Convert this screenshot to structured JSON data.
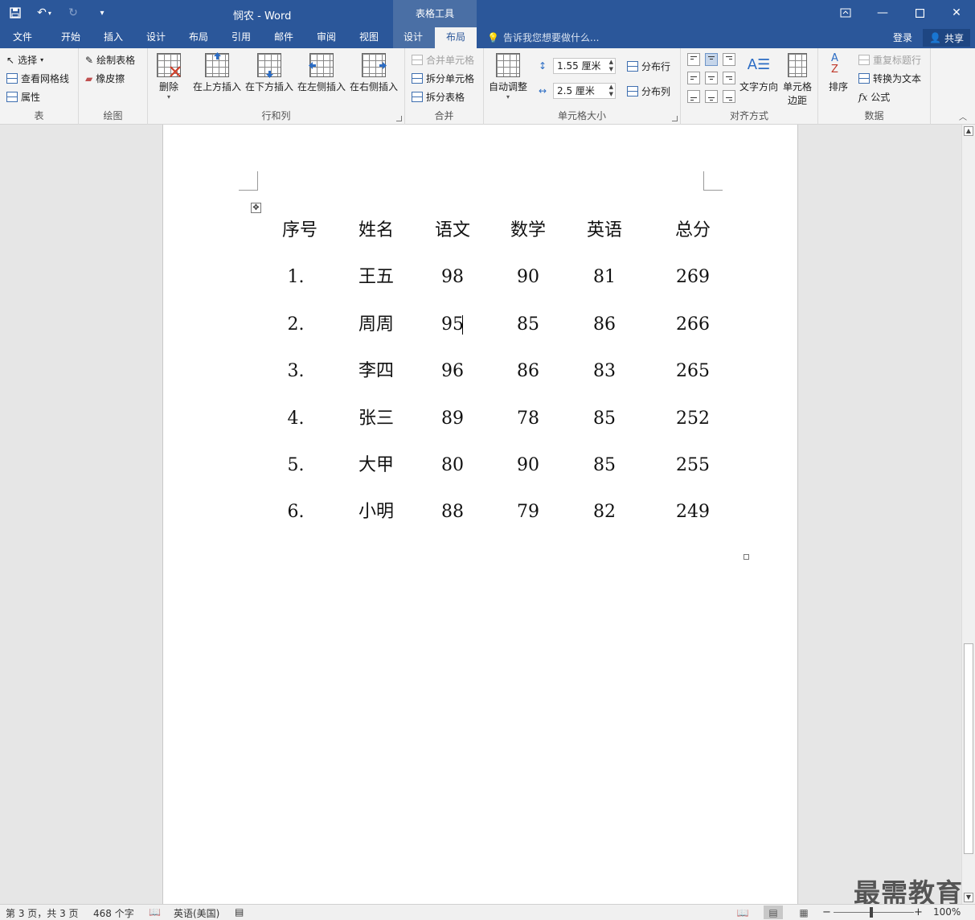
{
  "window": {
    "doc_title": "悯农 - Word",
    "context_tab_title": "表格工具",
    "minimize_icon": "minimize-icon",
    "maximize_icon": "maximize-icon",
    "close_icon": "close-icon"
  },
  "tabs": [
    {
      "label": "文件"
    },
    {
      "label": "开始"
    },
    {
      "label": "插入"
    },
    {
      "label": "设计"
    },
    {
      "label": "布局"
    },
    {
      "label": "引用"
    },
    {
      "label": "邮件"
    },
    {
      "label": "审阅"
    },
    {
      "label": "视图"
    },
    {
      "label": "设计"
    },
    {
      "label": "布局"
    }
  ],
  "active_tab_index": 10,
  "tellme": "告诉我您想要做什么...",
  "login": "登录",
  "share": "共享",
  "ribbon": {
    "table_group": {
      "label": "表",
      "select": "选择",
      "gridlines": "查看网格线",
      "properties": "属性"
    },
    "draw_group": {
      "label": "绘图",
      "draw_table": "绘制表格",
      "eraser": "橡皮擦"
    },
    "rows_group": {
      "label": "行和列",
      "delete": "删除",
      "insert_above": "在上方插入",
      "insert_below": "在下方插入",
      "insert_left": "在左侧插入",
      "insert_right": "在右侧插入"
    },
    "merge_group": {
      "label": "合并",
      "merge_cells": "合并单元格",
      "split_cells": "拆分单元格",
      "split_table": "拆分表格"
    },
    "size_group": {
      "label": "单元格大小",
      "autofit": "自动调整",
      "height": "1.55 厘米",
      "width": "2.5 厘米",
      "distribute_rows": "分布行",
      "distribute_cols": "分布列"
    },
    "align_group": {
      "label": "对齐方式",
      "text_direction": "文字方向",
      "cell_margins_1": "单元格",
      "cell_margins_2": "边距"
    },
    "data_group": {
      "label": "数据",
      "sort": "排序",
      "repeat_header": "重复标题行",
      "convert_text": "转换为文本",
      "formula": "公式"
    }
  },
  "table": {
    "headers": [
      "序号",
      "姓名",
      "语文",
      "数学",
      "英语",
      "总分"
    ],
    "rows": [
      [
        "1.",
        "王五",
        "98",
        "90",
        "81",
        "269"
      ],
      [
        "2.",
        "周周",
        "95",
        "85",
        "86",
        "266"
      ],
      [
        "3.",
        "李四",
        "96",
        "86",
        "83",
        "265"
      ],
      [
        "4.",
        "张三",
        "89",
        "78",
        "85",
        "252"
      ],
      [
        "5.",
        "大甲",
        "80",
        "90",
        "85",
        "255"
      ],
      [
        "6.",
        "小明",
        "88",
        "79",
        "82",
        "249"
      ]
    ]
  },
  "status": {
    "page": "第 3 页，共 3 页",
    "words": "468 个字",
    "language": "英语(美国)",
    "zoom": "100%"
  },
  "watermark": "最需教育"
}
